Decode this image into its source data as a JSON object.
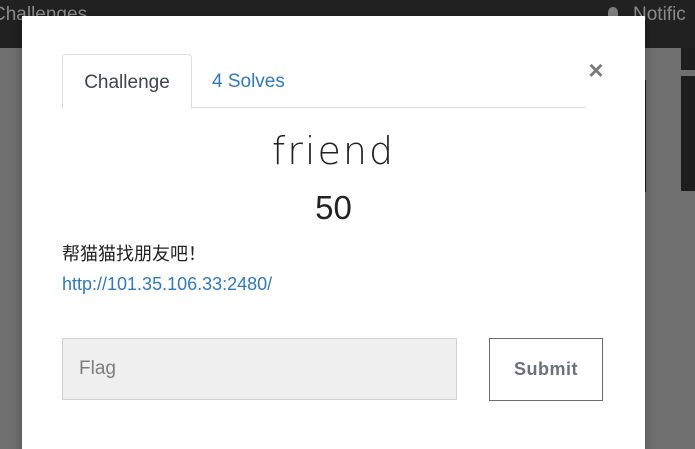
{
  "background": {
    "nav_brand": "Challenges",
    "nav_notifications": "Notific",
    "notifications_icon": "bell-icon"
  },
  "modal": {
    "close_label": "×",
    "tabs": [
      {
        "label": "Challenge",
        "active": true
      },
      {
        "label": "4 Solves",
        "active": false
      }
    ],
    "challenge": {
      "name": "friend",
      "value": "50",
      "description": "帮猫猫找朋友吧！",
      "link": "http://101.35.106.33:2480/"
    },
    "flag_input": {
      "value": "",
      "placeholder": "Flag"
    },
    "submit_label": "Submit"
  },
  "colors": {
    "link": "#337ab7",
    "navbar": "#212121",
    "overlay": "#6f6f6f"
  }
}
